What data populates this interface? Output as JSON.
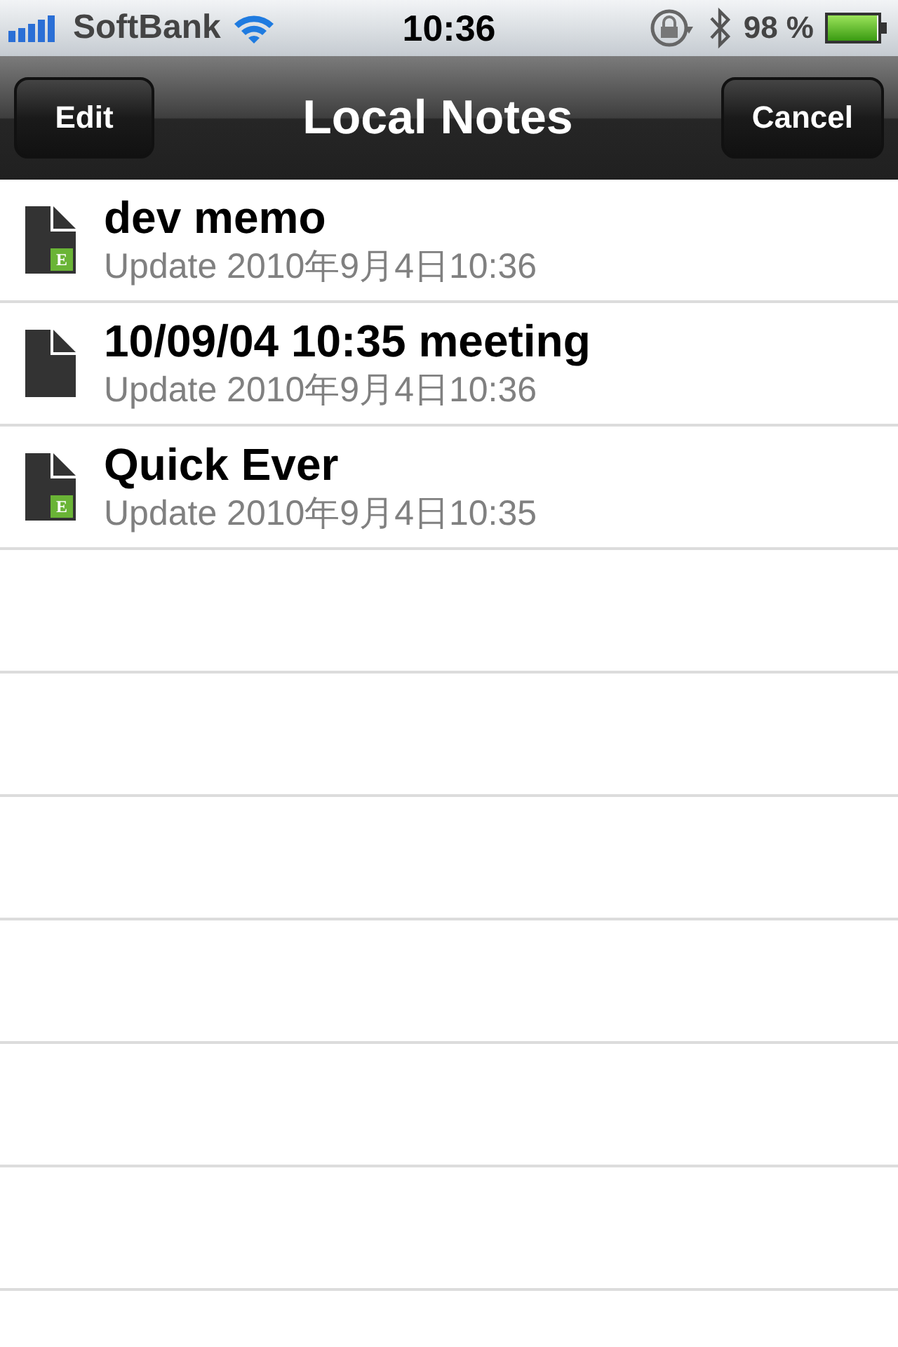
{
  "status_bar": {
    "carrier": "SoftBank",
    "time": "10:36",
    "battery": "98 %"
  },
  "nav_bar": {
    "left_button": "Edit",
    "title": "Local Notes",
    "right_button": "Cancel"
  },
  "notes": [
    {
      "title": "dev memo",
      "subtitle": "Update 2010年9月4日10:36",
      "badge": "E"
    },
    {
      "title": "10/09/04 10:35 meeting",
      "subtitle": "Update 2010年9月4日10:36"
    },
    {
      "title": "Quick Ever",
      "subtitle": "Update 2010年9月4日10:35",
      "badge": "E"
    }
  ]
}
